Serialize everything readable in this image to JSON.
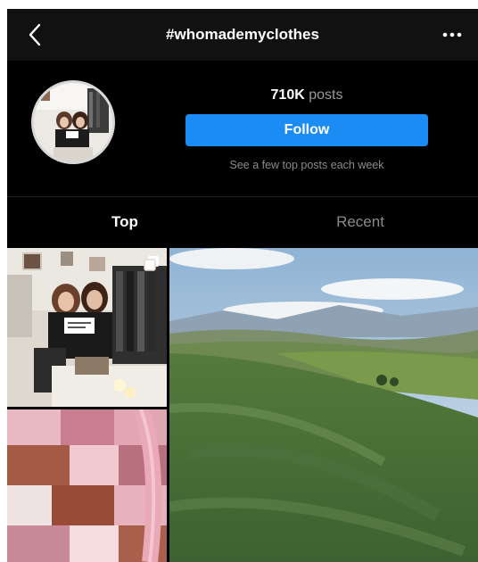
{
  "header": {
    "back_icon": "chevron-left-icon",
    "title": "#whomademyclothes",
    "more_icon": "ellipsis-icon"
  },
  "profile": {
    "avatar_icon": "hashtag-avatar-photo",
    "post_count": "710K",
    "post_count_label": "posts",
    "follow_label": "Follow",
    "note": "See a few top posts each week"
  },
  "tabs": [
    {
      "label": "Top",
      "active": true
    },
    {
      "label": "Recent",
      "active": false
    }
  ],
  "posts": [
    {
      "name": "post-boutique-photo",
      "icon": "multiple-photos-icon"
    },
    {
      "name": "post-patchwork-knit-photo"
    },
    {
      "name": "post-green-hills-video"
    }
  ],
  "colors": {
    "background": "#000000",
    "topbar": "#111111",
    "follow_button": "#1b8cf3",
    "secondary_text": "#8c8c8c"
  }
}
